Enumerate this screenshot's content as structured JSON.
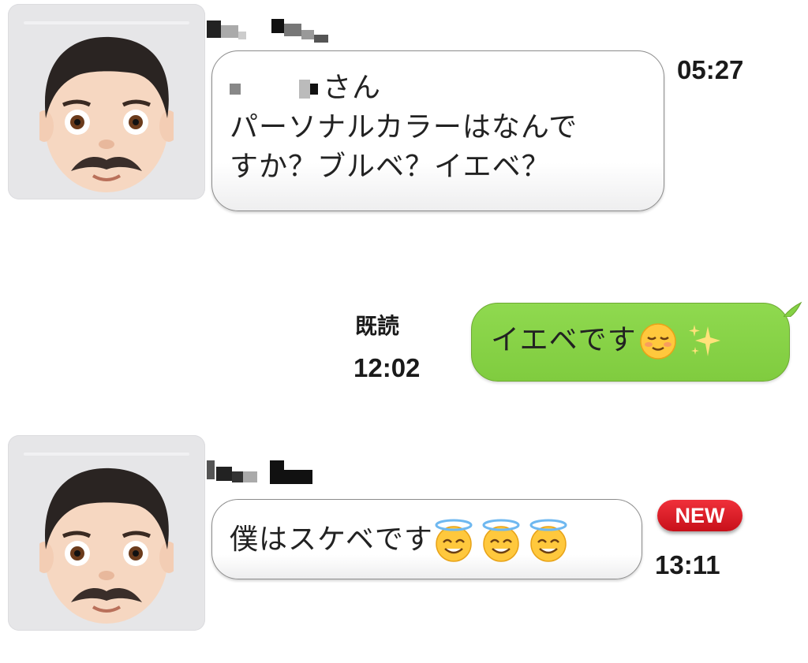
{
  "messages": [
    {
      "sender": "incoming",
      "lines": [
        "さん",
        "パーソナルカラーはなんで",
        "すか？ブルベ？イエベ？"
      ],
      "time": "05:27"
    },
    {
      "sender": "outgoing",
      "text": "イエベです",
      "emojis": [
        "relieved-smile-emoji",
        "sparkles-emoji"
      ],
      "read_label": "既読",
      "time": "12:02"
    },
    {
      "sender": "incoming",
      "text": "僕はスケベです",
      "emojis": [
        "halo-smile-emoji",
        "halo-smile-emoji",
        "halo-smile-emoji"
      ],
      "badge": "NEW",
      "time": "13:11"
    }
  ],
  "avatar": {
    "icon": "man-with-mustache-emoji"
  },
  "colors": {
    "outgoing_bubble": "#85d245",
    "incoming_bubble": "#ffffff",
    "new_badge": "#e0202c"
  }
}
